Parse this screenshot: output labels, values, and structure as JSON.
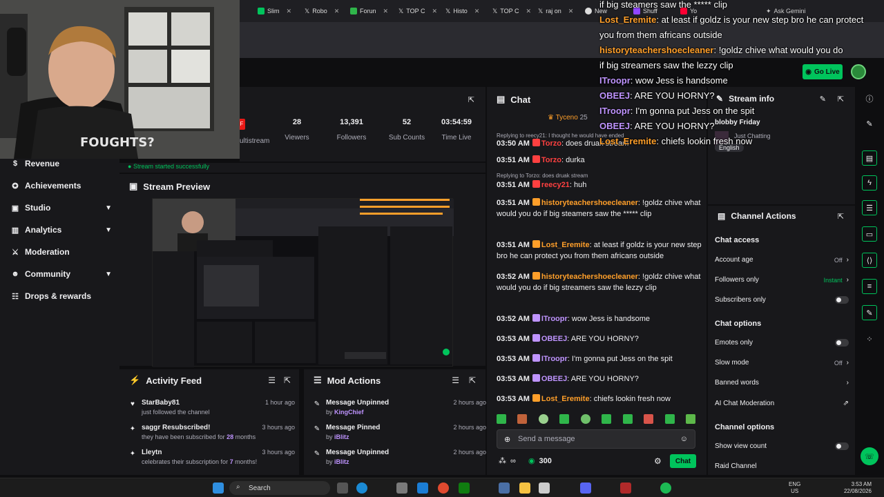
{
  "browser": {
    "tabs": [
      "Slim",
      "Robo",
      "Forun",
      "TOP C",
      "Histo",
      "TOP C",
      "raj on",
      "New",
      "Shuff",
      "Yo"
    ],
    "ask_gemini": "Ask Gemini"
  },
  "header": {
    "go_live": "Go Live"
  },
  "sidebar": {
    "items": [
      {
        "label": "Revenue",
        "icon": "coin-icon",
        "chevron": false
      },
      {
        "label": "Achievements",
        "icon": "trophy-icon",
        "chevron": false
      },
      {
        "label": "Studio",
        "icon": "studio-icon",
        "chevron": true
      },
      {
        "label": "Analytics",
        "icon": "chart-icon",
        "chevron": true
      },
      {
        "label": "Moderation",
        "icon": "sword-icon",
        "chevron": false
      },
      {
        "label": "Community",
        "icon": "people-icon",
        "chevron": true
      },
      {
        "label": "Drops & rewards",
        "icon": "gift-icon",
        "chevron": false
      }
    ]
  },
  "stats": {
    "multistream_label": "ultistream",
    "items": [
      {
        "value": "28",
        "label": "Viewers"
      },
      {
        "value": "13,391",
        "label": "Followers"
      },
      {
        "value": "52",
        "label": "Sub Counts"
      },
      {
        "value": "03:54:59",
        "label": "Time Live"
      }
    ]
  },
  "success_message": "Stream started successfully",
  "preview": {
    "title": "Stream Preview"
  },
  "activity_feed": {
    "title": "Activity Feed",
    "items": [
      {
        "title": "StarBaby81",
        "desc": "just followed the channel",
        "desc_bold": "",
        "desc_tail": "",
        "ago": "1 hour ago",
        "icon": "heart-icon"
      },
      {
        "title": "saggr Resubscribed!",
        "desc": "they have been subscribed for ",
        "desc_bold": "28",
        "desc_tail": " months",
        "ago": "3 hours ago",
        "icon": "star-icon"
      },
      {
        "title": "Lleytn",
        "desc": "celebrates their subscription for ",
        "desc_bold": "7",
        "desc_tail": " months!",
        "ago": "3 hours ago",
        "icon": "star-icon"
      }
    ]
  },
  "mod_actions": {
    "title": "Mod Actions",
    "items": [
      {
        "title": "Message Unpinned",
        "by": "by ",
        "user": "KingChief",
        "ago": "2 hours ago"
      },
      {
        "title": "Message Pinned",
        "by": "by ",
        "user": "iBlitz",
        "ago": "2 hours ago"
      },
      {
        "title": "Message Unpinned",
        "by": "by ",
        "user": "iBlitz",
        "ago": "2 hours ago"
      }
    ]
  },
  "chat": {
    "title": "Chat",
    "pinned_user": "Tyceno",
    "pinned_count": "25",
    "messages": [
      {
        "reply": "Replying to reecy21: I thought he would have ended",
        "ts": "03:50 AM",
        "user": "Torzo",
        "color": "#ff4040",
        "text": ": does druak stream"
      },
      {
        "reply": "",
        "ts": "03:51 AM",
        "user": "Torzo",
        "color": "#ff4040",
        "text": ": durka"
      },
      {
        "reply": "Replying to Torzo: does druak stream",
        "ts": "03:51 AM",
        "user": "reecy21",
        "color": "#ff4040",
        "text": ": huh"
      },
      {
        "reply": "",
        "ts": "03:51 AM",
        "user": "historyteachershoecleaner",
        "color": "#ff9f2a",
        "text": ": !goldz chive what would you do if big steamers saw the ***** clip"
      },
      {
        "reply": "",
        "ts": "03:51 AM",
        "user": "Lost_Eremite",
        "color": "#ff9f2a",
        "text": ": at least if goldz is your new step bro he can protect you from them africans outside"
      },
      {
        "reply": "",
        "ts": "03:52 AM",
        "user": "historyteachershoecleaner",
        "color": "#ff9f2a",
        "text": ": !goldz chive what would you do if big streamers saw the lezzy clip"
      },
      {
        "reply": "",
        "ts": "03:52 AM",
        "user": "ITroopr",
        "color": "#bf94ff",
        "text": ": wow Jess is handsome"
      },
      {
        "reply": "",
        "ts": "03:53 AM",
        "user": "OBEEJ",
        "color": "#bf94ff",
        "text": ": ARE YOU HORNY?"
      },
      {
        "reply": "",
        "ts": "03:53 AM",
        "user": "ITroopr",
        "color": "#bf94ff",
        "text": ": I'm gonna put Jess on the spit"
      },
      {
        "reply": "",
        "ts": "03:53 AM",
        "user": "OBEEJ",
        "color": "#bf94ff",
        "text": ": ARE YOU HORNY?"
      },
      {
        "reply": "",
        "ts": "03:53 AM",
        "user": "Lost_Eremite",
        "color": "#ff9f2a",
        "text": ": chiefs lookin fresh now"
      }
    ],
    "input_placeholder": "Send a message",
    "points": "300",
    "infinity": "∞",
    "send_label": "Chat"
  },
  "stream_info": {
    "title": "Stream info",
    "stream_title": "blobby Friday",
    "category": "Just Chatting",
    "language": "English"
  },
  "channel_actions": {
    "title": "Channel Actions",
    "chat_access": "Chat access",
    "account_age": "Account age",
    "account_age_val": "Off",
    "followers_only": "Followers only",
    "followers_only_val": "Instant",
    "subscribers_only": "Subscribers only",
    "chat_options": "Chat options",
    "emotes_only": "Emotes only",
    "slow_mode": "Slow mode",
    "slow_mode_val": "Off",
    "banned_words": "Banned words",
    "ai_moderation": "AI Chat Moderation",
    "channel_options": "Channel options",
    "show_view_count": "Show view count",
    "raid_channel": "Raid Channel"
  },
  "overlay": [
    {
      "user": "",
      "text": "if big steamers saw the ***** clip",
      "ucolor": "#ffffff"
    },
    {
      "user": "Lost_Eremite",
      "text": ": at least if goldz is your new step bro he can protect",
      "ucolor": "#ff9f2a"
    },
    {
      "user": "",
      "text": "you from them africans outside",
      "ucolor": "#ffffff"
    },
    {
      "user": "historyteachershoecleaner",
      "text": ": !goldz chive what would you do",
      "ucolor": "#ff9f2a"
    },
    {
      "user": "",
      "text": "if big streamers saw the lezzy clip",
      "ucolor": "#ffffff"
    },
    {
      "user": "ITroopr",
      "text": ": wow Jess is handsome",
      "ucolor": "#bf94ff"
    },
    {
      "user": "OBEEJ",
      "text": ": ARE YOU HORNY?",
      "ucolor": "#bf94ff"
    },
    {
      "user": "ITroopr",
      "text": ": I'm gonna put Jess on the spit",
      "ucolor": "#bf94ff"
    },
    {
      "user": "OBEEJ",
      "text": ": ARE YOU HORNY?",
      "ucolor": "#bf94ff"
    },
    {
      "user": "Lost_Eremite",
      "text": ": chiefs lookin fresh now",
      "ucolor": "#ff9f2a"
    }
  ],
  "webcam": {
    "shirt_text": "FOUGHTS?"
  },
  "taskbar": {
    "search": "Search",
    "lang": "ENG",
    "region": "US",
    "time": "3:53 AM",
    "date": "22/08/2026"
  },
  "colors": {
    "accent": "#00c45c",
    "bg": "#0e0e10",
    "panel": "#18181b",
    "purple": "#bf94ff"
  }
}
